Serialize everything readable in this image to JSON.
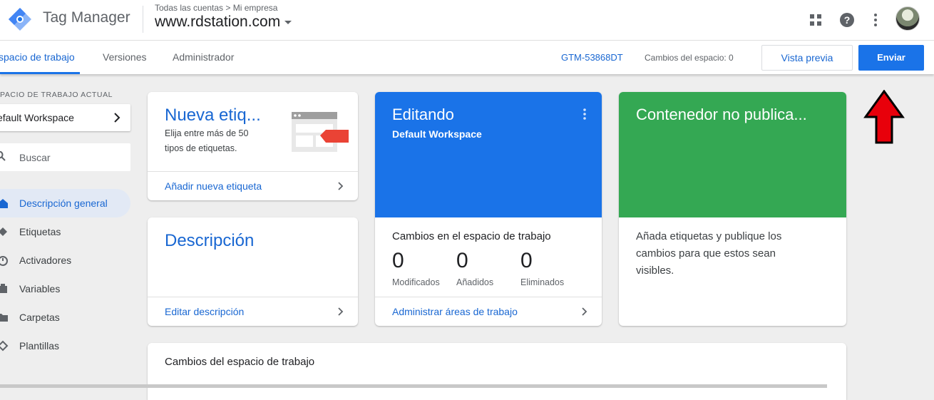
{
  "header": {
    "app_title": "Tag Manager",
    "breadcrumb_account": "Todas las cuentas",
    "breadcrumb_sep": ">",
    "breadcrumb_container_group": "Mi empresa",
    "container_name": "www.rdstation.com",
    "icons": [
      "apps-icon",
      "help-icon",
      "more-vert-icon",
      "avatar"
    ]
  },
  "tabs": {
    "workspace": "spacio de trabajo",
    "versions": "Versiones",
    "admin": "Administrador"
  },
  "toolbar": {
    "gtm_id": "GTM-53868DT",
    "workspace_changes": "Cambios del espacio: 0",
    "preview_label": "Vista previa",
    "submit_label": "Enviar"
  },
  "sidebar": {
    "current_ws_label": "PACIO DE TRABAJO ACTUAL",
    "current_ws_name": "efault Workspace",
    "search_placeholder": "Buscar",
    "items": [
      {
        "label": "Descripción general",
        "icon": "overview-icon",
        "active": true
      },
      {
        "label": "Etiquetas",
        "icon": "tag-icon"
      },
      {
        "label": "Activadores",
        "icon": "trigger-icon"
      },
      {
        "label": "Variables",
        "icon": "variables-icon"
      },
      {
        "label": "Carpetas",
        "icon": "folder-icon"
      },
      {
        "label": "Plantillas",
        "icon": "template-icon"
      }
    ]
  },
  "cards": {
    "new_tag": {
      "title": "Nueva etiq...",
      "desc_line1": "Elija entre más de 50",
      "desc_line2": "tipos de etiquetas.",
      "link": "Añadir nueva etiqueta"
    },
    "description": {
      "title": "Descripción",
      "link": "Editar descripción"
    },
    "editing": {
      "title": "Editando",
      "workspace": "Default Workspace",
      "changes_title": "Cambios en el espacio de trabajo",
      "stats": [
        {
          "value": "0",
          "label": "Modificados"
        },
        {
          "value": "0",
          "label": "Añadidos"
        },
        {
          "value": "0",
          "label": "Eliminados"
        }
      ],
      "link": "Administrar áreas de trabajo"
    },
    "container": {
      "title": "Contenedor no publica...",
      "desc_line1": "Añada etiquetas y publique los",
      "desc_line2": "cambios para que estos sean",
      "desc_line3": "visibles."
    },
    "workspace_changes": {
      "title": "Cambios del espacio de trabajo"
    }
  },
  "colors": {
    "brand_blue": "#1a73e8",
    "link_blue": "#1967d2",
    "editing_blue": "#1a73e8",
    "container_green": "#34a853",
    "annotation_arrow": "#e8000b"
  }
}
